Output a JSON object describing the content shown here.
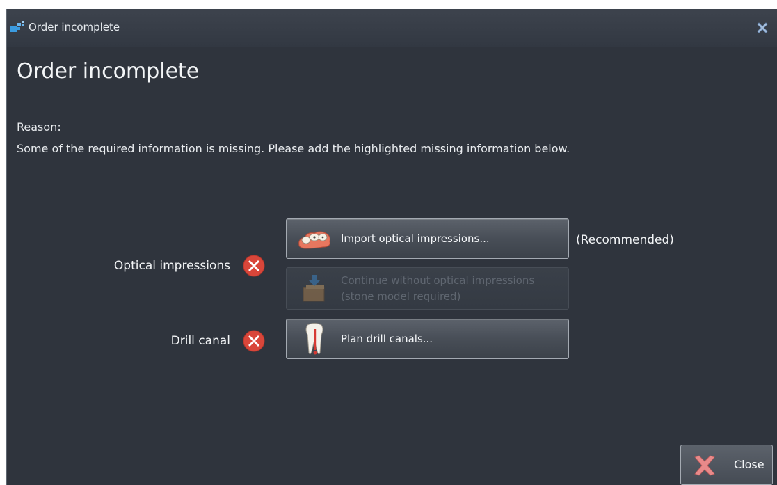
{
  "window": {
    "title": "Order incomplete",
    "app_icon": "app-logo-icon",
    "close_icon": "close-x-icon"
  },
  "heading": "Order incomplete",
  "reason": {
    "label": "Reason:",
    "text": "Some of the required information is missing. Please add the highlighted missing information below."
  },
  "rows": {
    "optical": {
      "label": "Optical impressions",
      "status_icon": "error-icon",
      "import_button": {
        "label": "Import optical impressions...",
        "icon": "optical-impression-icon"
      },
      "import_hint": "(Recommended)",
      "continue_button": {
        "label_line1": "Continue without optical impressions",
        "label_line2": "(stone model required)",
        "icon": "stone-model-icon",
        "enabled": false
      }
    },
    "drill": {
      "label": "Drill canal",
      "status_icon": "error-icon",
      "plan_button": {
        "label": "Plan drill canals...",
        "icon": "tooth-drill-icon"
      }
    }
  },
  "footer": {
    "close_label": "Close",
    "close_icon": "close-x-icon"
  },
  "colors": {
    "background": "#2f343d",
    "error": "#d9463a",
    "close_x": "#9fb6d6"
  }
}
